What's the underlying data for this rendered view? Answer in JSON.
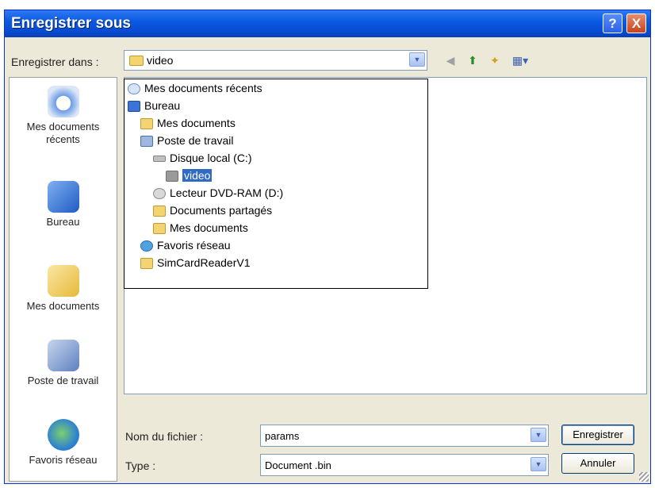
{
  "dialog": {
    "title": "Enregistrer sous",
    "help_label": "?",
    "close_label": "X"
  },
  "save_in": {
    "label": "Enregistrer dans :",
    "value": "video"
  },
  "toolbar": {
    "icons": [
      "back-icon",
      "up-folder-icon",
      "new-folder-icon",
      "view-menu-icon"
    ]
  },
  "places": [
    {
      "label": "Mes documents récents",
      "icon": "recent-documents-icon"
    },
    {
      "label": "Bureau",
      "icon": "desktop-icon"
    },
    {
      "label": "Mes documents",
      "icon": "my-documents-icon"
    },
    {
      "label": "Poste de travail",
      "icon": "my-computer-icon"
    },
    {
      "label": "Favoris réseau",
      "icon": "network-places-icon"
    }
  ],
  "location_list": [
    {
      "label": "Mes documents récents",
      "icon": "recent-documents-icon"
    },
    {
      "label": "Bureau",
      "icon": "desktop-icon"
    },
    {
      "label": "Mes documents",
      "icon": "my-documents-icon"
    },
    {
      "label": "Poste de travail",
      "icon": "my-computer-icon"
    },
    {
      "label": "Disque local (C:)",
      "icon": "hard-drive-icon"
    },
    {
      "label": "video",
      "icon": "folder-icon",
      "selected": true
    },
    {
      "label": "Lecteur DVD-RAM (D:)",
      "icon": "dvd-drive-icon"
    },
    {
      "label": "Documents partagés",
      "icon": "shared-folder-icon"
    },
    {
      "label": "Mes documents",
      "icon": "folder-icon"
    },
    {
      "label": "Favoris réseau",
      "icon": "network-places-icon"
    },
    {
      "label": "SimCardReaderV1",
      "icon": "folder-icon"
    }
  ],
  "filename": {
    "label": "Nom du fichier :",
    "value": "params"
  },
  "filetype": {
    "label": "Type :",
    "value": "Document .bin"
  },
  "buttons": {
    "save": "Enregistrer",
    "cancel": "Annuler"
  },
  "colors": {
    "titlebar": "#0a5ae4",
    "selection": "#316ac5",
    "dialog_bg": "#ece9d8"
  }
}
